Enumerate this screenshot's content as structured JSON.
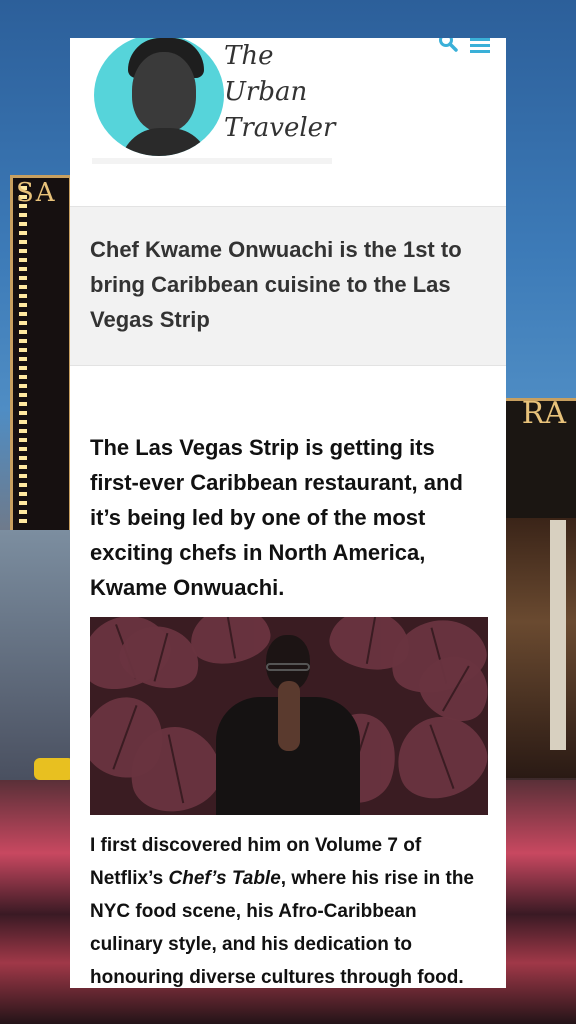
{
  "site": {
    "logo_line1": "The",
    "logo_line2": "Urban",
    "logo_line3": "Traveler"
  },
  "header": {
    "search_icon": "search-icon",
    "menu_icon": "hamburger-menu-icon",
    "accent_color": "#3ab0d8"
  },
  "background": {
    "sign_left": "SA",
    "sign_right": "RA"
  },
  "article": {
    "title": "Chef Kwame Onwuachi is the 1st to bring Caribbean cuisine to the Las Vegas Strip",
    "lead": "The Las Vegas Strip is getting its first-ever Caribbean restaurant, and it’s being led by one of the most exciting chefs in North America, Kwame Onwuachi.",
    "body_part1": "I first discovered him on Volume 7 of Netflix’s ",
    "body_emph": "Chef’s Table",
    "body_part2": ", where his rise in the NYC food scene, his Afro-Caribbean culinary style, and his dedication to honouring diverse cultures through food."
  }
}
